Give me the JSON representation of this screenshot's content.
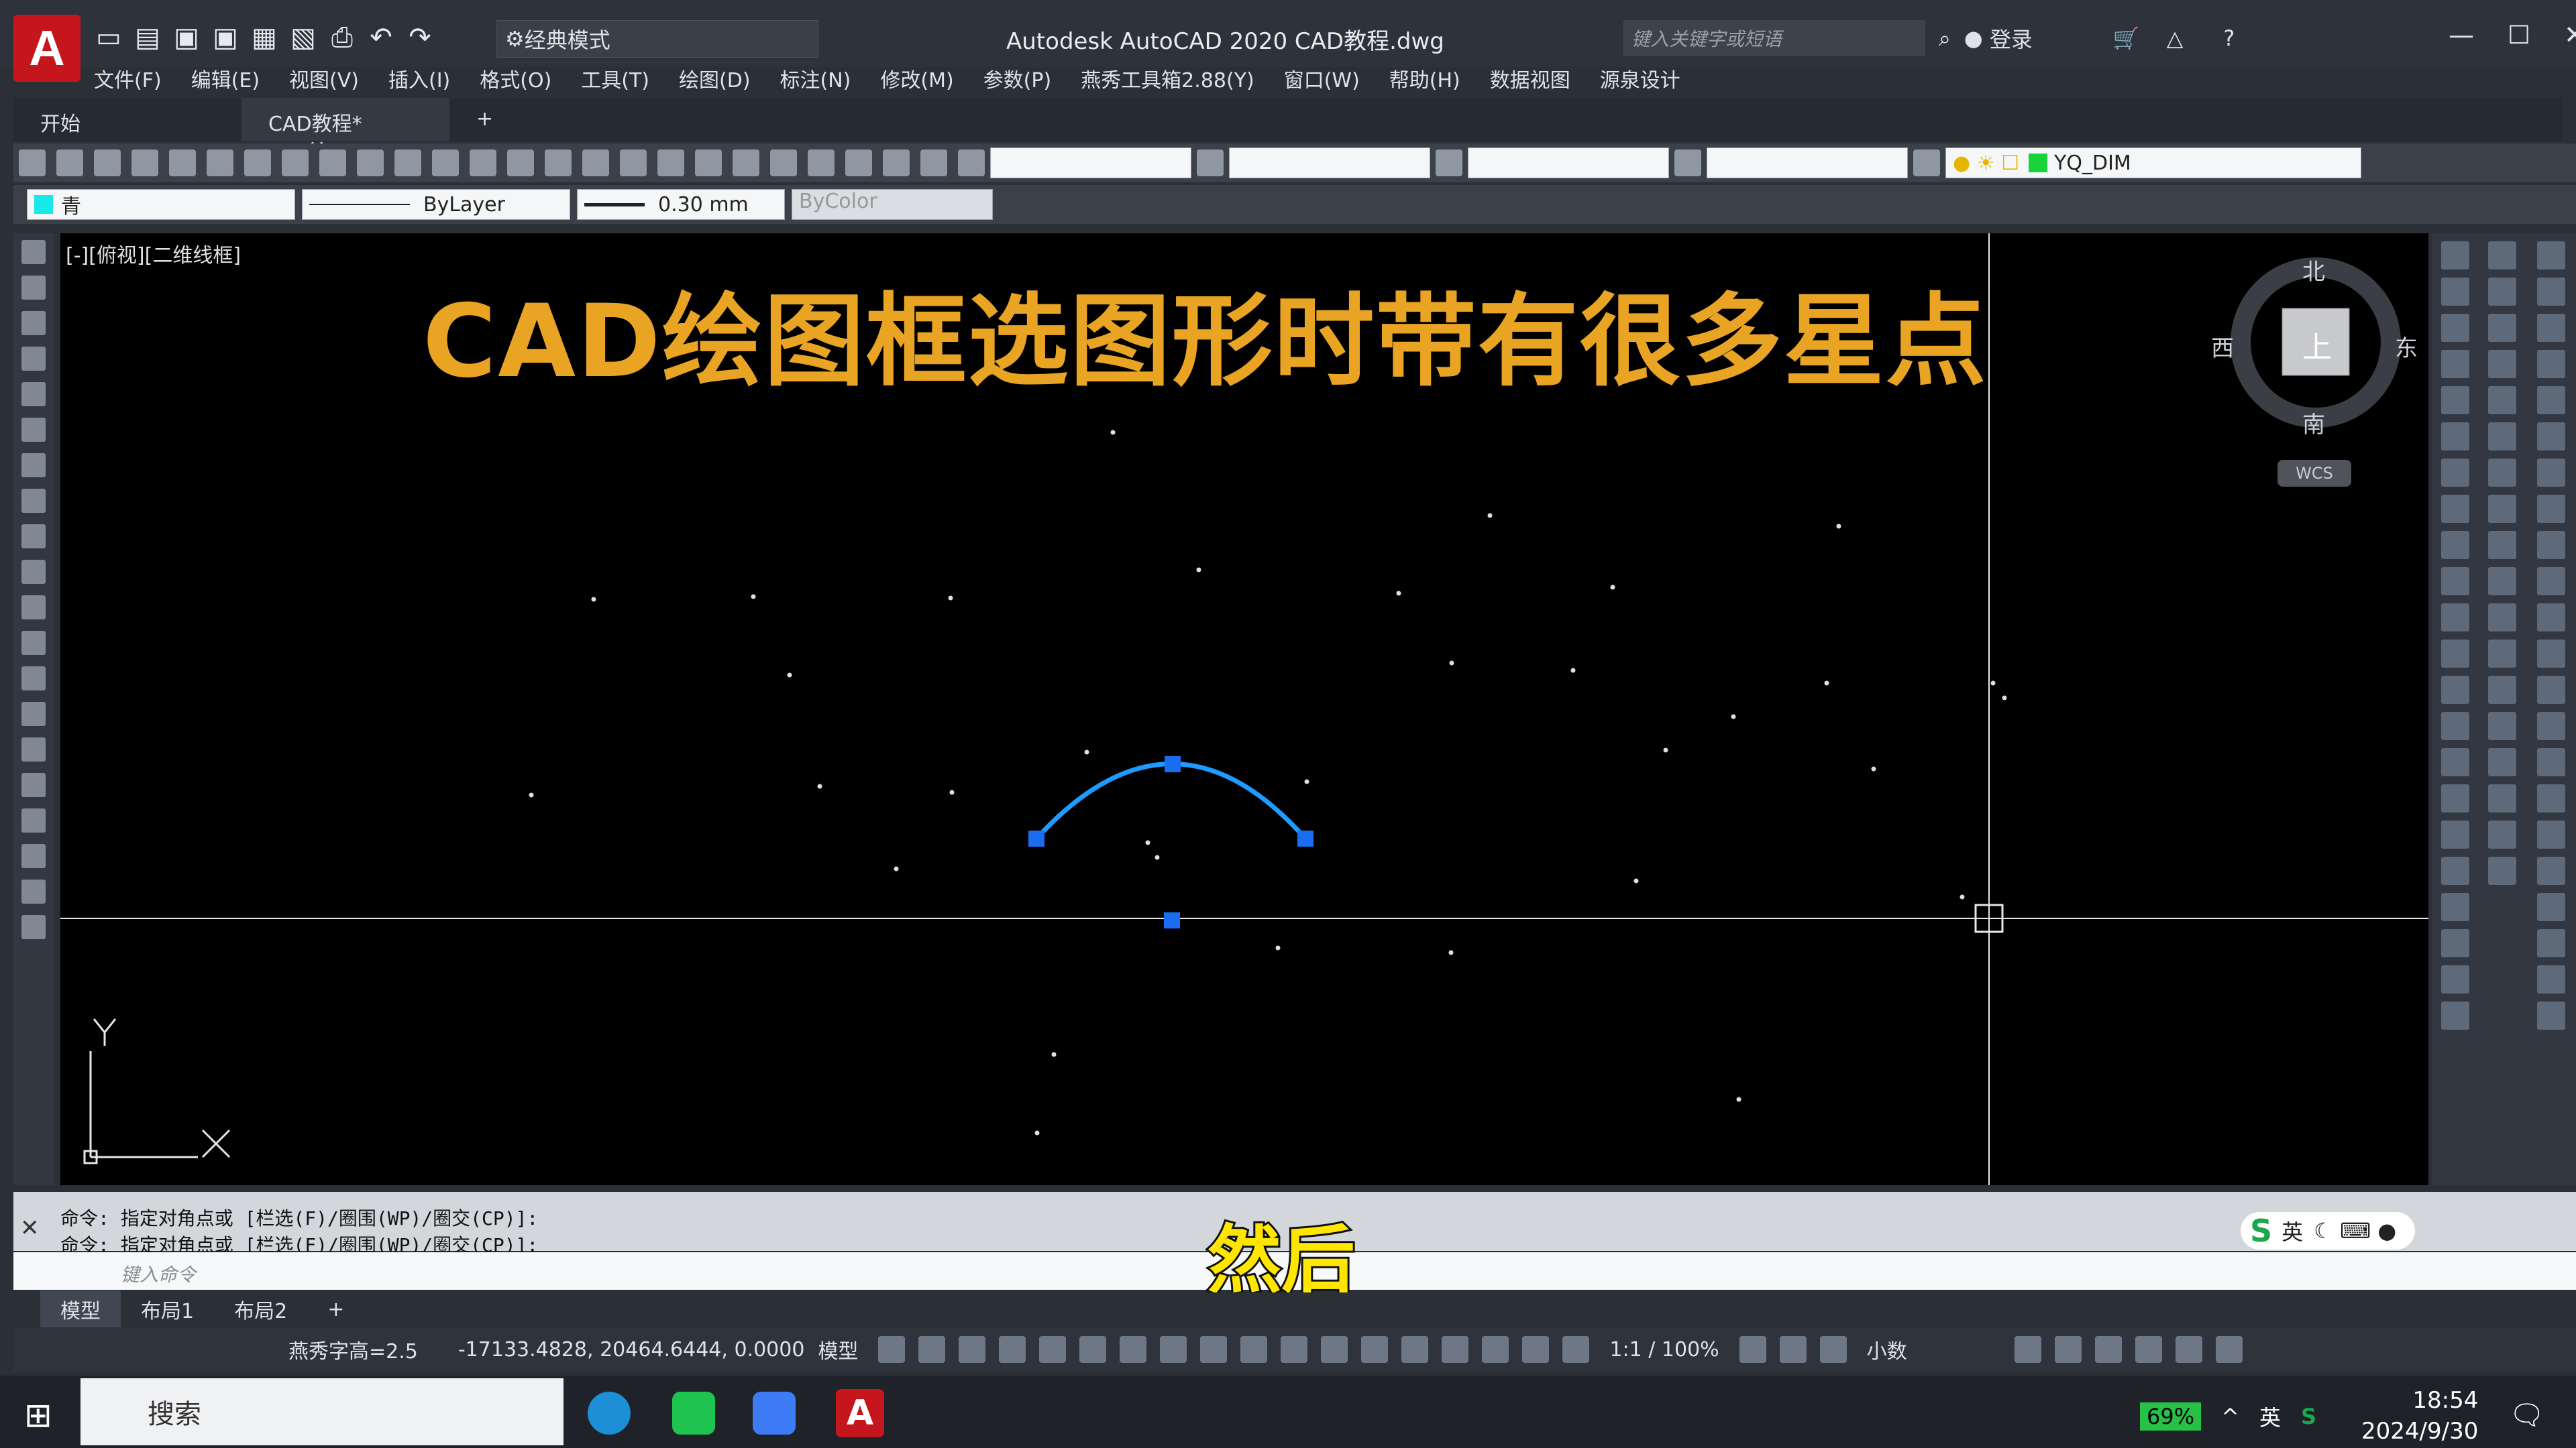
{
  "titlebar": {
    "app_title": "Autodesk AutoCAD 2020    CAD教程.dwg",
    "workspace": "经典模式",
    "search_placeholder": "键入关键字或短语",
    "login": "登录",
    "app_logo": "A"
  },
  "menu": [
    "文件(F)",
    "编辑(E)",
    "视图(V)",
    "插入(I)",
    "格式(O)",
    "工具(T)",
    "绘图(D)",
    "标注(N)",
    "修改(M)",
    "参数(P)",
    "燕秀工具箱2.88(Y)",
    "窗口(W)",
    "帮助(H)",
    "数据视图",
    "源泉设计"
  ],
  "tabs": {
    "start": "开始",
    "doc": "CAD教程*",
    "add": "+"
  },
  "toolbar": {
    "dim_style": "YQ_DIM",
    "color": "青",
    "linetype": "ByLayer",
    "lineweight": "0.30 mm",
    "plotstyle": "ByColor"
  },
  "canvas": {
    "view_label": "[-][俯视][二维线框]",
    "overlay_title": "CAD绘图框选图形时带有很多星点",
    "viewcube": {
      "north": "北",
      "south": "南",
      "west": "西",
      "east": "东",
      "top": "上",
      "wcs": "WCS"
    },
    "ucs": {
      "x": "X",
      "y": "Y"
    }
  },
  "command": {
    "history": [
      "命令: 指定对角点或 [栏选(F)/圈围(WP)/圈交(CP)]:",
      "命令: 指定对角点或 [栏选(F)/圈围(WP)/圈交(CP)]:"
    ],
    "placeholder": "键入命令"
  },
  "subtitle": "然后",
  "ime": {
    "label": "英"
  },
  "layout_tabs": [
    "模型",
    "布局1",
    "布局2",
    "+"
  ],
  "status": {
    "text_height": "燕秀字高=2.5",
    "coords": "-17133.4828, 20464.6444, 0.0000",
    "space": "模型",
    "scale": "1:1 / 100%",
    "units": "小数"
  },
  "taskbar": {
    "search": "搜索",
    "battery": "69%",
    "ime": "英",
    "time": "18:54",
    "date": "2024/9/30"
  }
}
